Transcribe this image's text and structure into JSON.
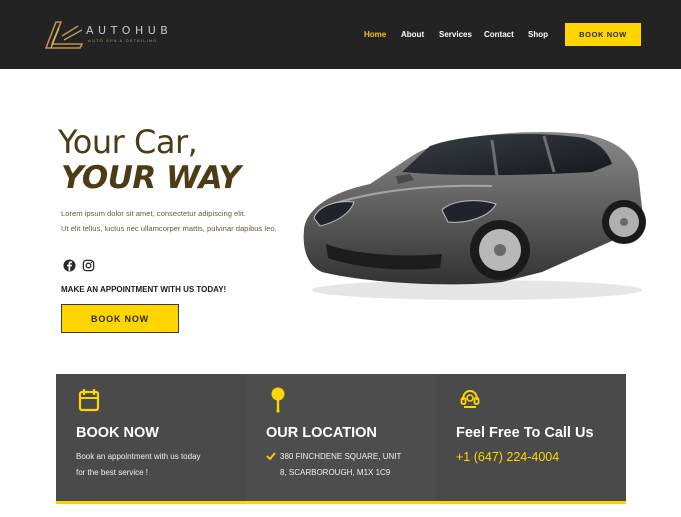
{
  "brand": {
    "name": "AUTOHUB",
    "tagline": "AUTO SPA & DETAILING"
  },
  "nav": {
    "items": [
      {
        "label": "Home",
        "active": true
      },
      {
        "label": "About",
        "active": false
      },
      {
        "label": "Services",
        "active": false
      },
      {
        "label": "Contact",
        "active": false
      },
      {
        "label": "Shop",
        "active": false
      }
    ],
    "cta_label": "BOOK NOW"
  },
  "hero": {
    "title_line1": "Your Car,",
    "title_line2": "YOUR WAY",
    "body_line1": "Lorem ipsum dolor sit amet, consectetur adipiscing elit.",
    "body_line2": "Ut elit tellus, luctus nec ullamcorper mattis, pulvinar dapibus leo.",
    "social_icons": [
      "facebook-icon",
      "instagram-icon"
    ],
    "appointment_text": "MAKE AN APPOINTMENT WITH US TODAY!",
    "button_label": "BOOK NOW"
  },
  "info": {
    "book": {
      "icon": "calendar-icon",
      "title": "BOOK NOW",
      "line1": "Book an appointment with us today",
      "line2": "for the best service !"
    },
    "location": {
      "icon": "map-pin-icon",
      "title": "OUR LOCATION",
      "line1": "380 FINCHDENE SQUARE, UNIT",
      "line2": "8, SCARBOROUGH, M1X 1C9"
    },
    "call": {
      "icon": "headset-icon",
      "title": "Feel Free To Call Us",
      "phone": "+1 (647) 224-4004"
    }
  },
  "colors": {
    "accent": "#ffd500",
    "header_bg": "#232323",
    "band_bg": "#4a4a4a",
    "hero_text": "#4c3c16"
  }
}
